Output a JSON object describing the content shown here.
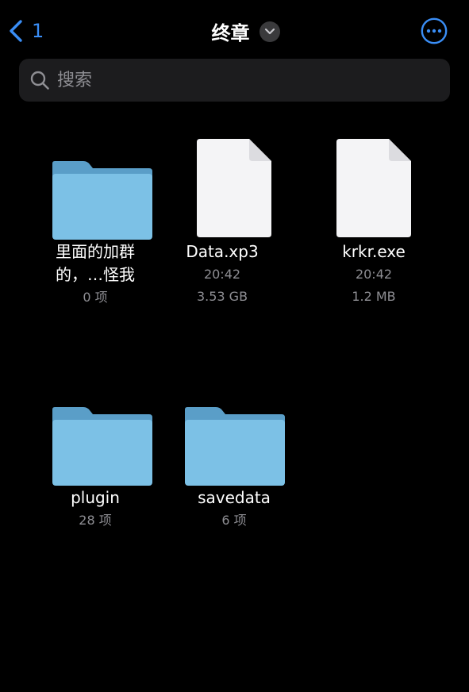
{
  "nav": {
    "back_label": "1",
    "title": "终章"
  },
  "search": {
    "placeholder": "搜索",
    "value": ""
  },
  "items": [
    {
      "type": "folder",
      "name_line1": "里面的加群",
      "name_line2": "的，…怪我",
      "meta1": "0 项",
      "meta2": ""
    },
    {
      "type": "file",
      "name_line1": "Data.xp3",
      "name_line2": "",
      "meta1": "20:42",
      "meta2": "3.53 GB"
    },
    {
      "type": "file",
      "name_line1": "krkr.exe",
      "name_line2": "",
      "meta1": "20:42",
      "meta2": "1.2 MB"
    },
    {
      "type": "folder",
      "name_line1": "plugin",
      "name_line2": "",
      "meta1": "28 项",
      "meta2": ""
    },
    {
      "type": "folder",
      "name_line1": "savedata",
      "name_line2": "",
      "meta1": "6 项",
      "meta2": ""
    }
  ],
  "colors": {
    "accent": "#3a8ef6",
    "background": "#000000",
    "folder_front": "#7cc1e6",
    "folder_back": "#5a9ec8",
    "secondary_text": "#8e8e93"
  },
  "icons": {
    "back": "chevron-left-icon",
    "title_menu": "chevron-down-icon",
    "more": "ellipsis-circle-icon",
    "search": "magnifier-icon",
    "folder": "folder-icon",
    "file": "document-icon"
  }
}
